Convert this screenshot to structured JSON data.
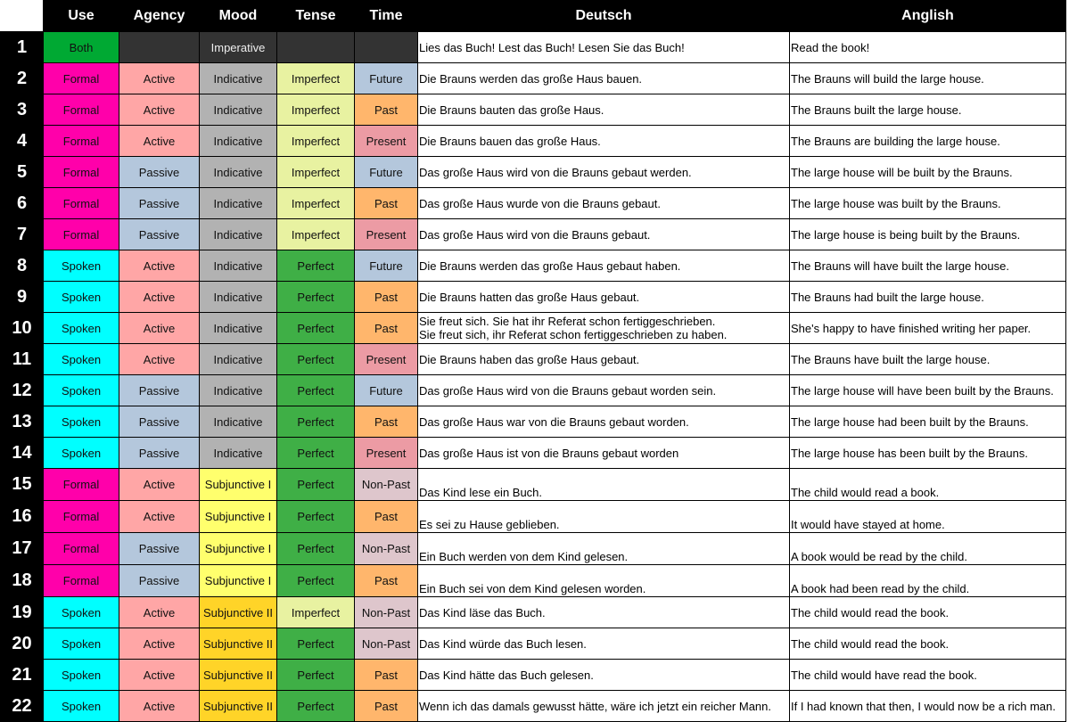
{
  "headers": [
    "",
    "Use",
    "Agency",
    "Mood",
    "Tense",
    "Time",
    "Deutsch",
    "Anglish"
  ],
  "colors": {
    "Both": "#00a933",
    "Formal": "#ff00aa",
    "Spoken": "#00ffff",
    "Active": "#ffa6a6",
    "Passive": "#b4c7dc",
    "Imperative": "#333333",
    "Indicative": "#b2b2b2",
    "Subjunctive I": "#ffff6d",
    "Subjunctive II": "#ffd428",
    "Imperfect": "#e8f2a1",
    "Perfect": "#3faf46",
    "Future": "#b4c7dc",
    "Past": "#ffb66c",
    "Present": "#ec9ba4",
    "Non-Past": "#dec6cc",
    "empty": "#333333"
  },
  "rows": [
    {
      "n": "1",
      "use": "Both",
      "agency": "",
      "mood": "Imperative",
      "tense": "",
      "time": "",
      "de": "Lies das Buch! Lest das Buch! Lesen Sie das Buch!",
      "en": "Read the book!"
    },
    {
      "n": "2",
      "use": "Formal",
      "agency": "Active",
      "mood": "Indicative",
      "tense": "Imperfect",
      "time": "Future",
      "de": "Die Brauns werden das große Haus bauen.",
      "en": "The Brauns will build the large house."
    },
    {
      "n": "3",
      "use": "Formal",
      "agency": "Active",
      "mood": "Indicative",
      "tense": "Imperfect",
      "time": "Past",
      "de": "Die Brauns bauten das große Haus.",
      "en": "The Brauns built the large house."
    },
    {
      "n": "4",
      "use": "Formal",
      "agency": "Active",
      "mood": "Indicative",
      "tense": "Imperfect",
      "time": "Present",
      "de": "Die Brauns bauen das große Haus.",
      "en": "The Brauns are building the large house."
    },
    {
      "n": "5",
      "use": "Formal",
      "agency": "Passive",
      "mood": "Indicative",
      "tense": "Imperfect",
      "time": "Future",
      "de": "Das große Haus wird von die Brauns gebaut werden.",
      "en": "The large house will be built by the Brauns."
    },
    {
      "n": "6",
      "use": "Formal",
      "agency": "Passive",
      "mood": "Indicative",
      "tense": "Imperfect",
      "time": "Past",
      "de": "Das große Haus wurde von die Brauns gebaut.",
      "en": "The large house was built by the Brauns."
    },
    {
      "n": "7",
      "use": "Formal",
      "agency": "Passive",
      "mood": "Indicative",
      "tense": "Imperfect",
      "time": "Present",
      "de": "Das große Haus wird von die Brauns gebaut.",
      "en": "The large house is being built by the Brauns."
    },
    {
      "n": "8",
      "use": "Spoken",
      "agency": "Active",
      "mood": "Indicative",
      "tense": "Perfect",
      "time": "Future",
      "de": "Die Brauns werden das große Haus gebaut haben.",
      "en": "The Brauns will have built the large house."
    },
    {
      "n": "9",
      "use": "Spoken",
      "agency": "Active",
      "mood": "Indicative",
      "tense": "Perfect",
      "time": "Past",
      "de": "Die Brauns hatten das große Haus gebaut.",
      "en": "The Brauns had built the large house."
    },
    {
      "n": "10",
      "use": "Spoken",
      "agency": "Active",
      "mood": "Indicative",
      "tense": "Perfect",
      "time": "Past",
      "de": "Sie freut sich. Sie hat ihr Referat schon fertiggeschrieben.\nSie freut sich, ihr Referat schon fertiggeschrieben zu haben.",
      "en": "She's happy to have finished writing her paper."
    },
    {
      "n": "11",
      "use": "Spoken",
      "agency": "Active",
      "mood": "Indicative",
      "tense": "Perfect",
      "time": "Present",
      "de": "Die Brauns haben das große Haus gebaut.",
      "en": "The Brauns have built the large house."
    },
    {
      "n": "12",
      "use": "Spoken",
      "agency": "Passive",
      "mood": "Indicative",
      "tense": "Perfect",
      "time": "Future",
      "de": "Das große Haus wird von die Brauns gebaut worden sein.",
      "en": "The large house will have been built by the Brauns."
    },
    {
      "n": "13",
      "use": "Spoken",
      "agency": "Passive",
      "mood": "Indicative",
      "tense": "Perfect",
      "time": "Past",
      "de": "Das große Haus war von die Brauns gebaut worden.",
      "en": "The large house had been built by the Brauns."
    },
    {
      "n": "14",
      "use": "Spoken",
      "agency": "Passive",
      "mood": "Indicative",
      "tense": "Perfect",
      "time": "Present",
      "de": "Das große Haus ist von die Brauns gebaut worden",
      "en": "The large house has been built by the Brauns."
    },
    {
      "n": "15",
      "use": "Formal",
      "agency": "Active",
      "mood": "Subjunctive I",
      "tense": "Perfect",
      "time": "Non-Past",
      "de": "Das Kind lese ein Buch.",
      "en": "The child would read a book.",
      "bottom": true
    },
    {
      "n": "16",
      "use": "Formal",
      "agency": "Active",
      "mood": "Subjunctive I",
      "tense": "Perfect",
      "time": "Past",
      "de": "Es sei zu Hause geblieben.",
      "en": "It would have stayed at home.",
      "bottom": true
    },
    {
      "n": "17",
      "use": "Formal",
      "agency": "Passive",
      "mood": "Subjunctive I",
      "tense": "Perfect",
      "time": "Non-Past",
      "de": "Ein Buch werden von dem Kind gelesen.",
      "en": "A book would be read by the child.",
      "bottom": true
    },
    {
      "n": "18",
      "use": "Formal",
      "agency": "Passive",
      "mood": "Subjunctive I",
      "tense": "Perfect",
      "time": "Past",
      "de": "Ein Buch sei von dem Kind gelesen worden.",
      "en": "A book had been read by the child.",
      "bottom": true
    },
    {
      "n": "19",
      "use": "Spoken",
      "agency": "Active",
      "mood": "Subjunctive II",
      "tense": "Imperfect",
      "time": "Non-Past",
      "de": "Das Kind läse das Buch.",
      "en": "The child would read the book."
    },
    {
      "n": "20",
      "use": "Spoken",
      "agency": "Active",
      "mood": "Subjunctive II",
      "tense": "Perfect",
      "time": "Non-Past",
      "de": "Das Kind würde das Buch lesen.",
      "en": "The child would read the book."
    },
    {
      "n": "21",
      "use": "Spoken",
      "agency": "Active",
      "mood": "Subjunctive II",
      "tense": "Perfect",
      "time": "Past",
      "de": "Das Kind hätte das Buch gelesen.",
      "en": "The child would have read the book."
    },
    {
      "n": "22",
      "use": "Spoken",
      "agency": "Active",
      "mood": "Subjunctive II",
      "tense": "Perfect",
      "time": "Past",
      "de": "Wenn ich das damals gewusst hätte, wäre ich jetzt ein reicher Mann.",
      "en": "If I had known that then, I would now be a rich man."
    }
  ]
}
